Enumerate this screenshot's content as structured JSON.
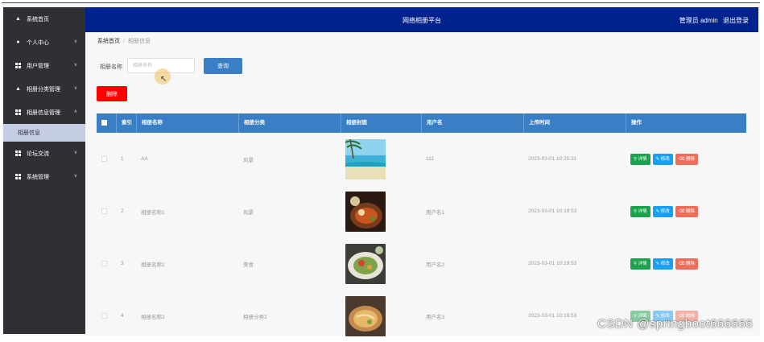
{
  "header": {
    "title": "网络相册平台",
    "admin_label": "管理员 admin",
    "logout_label": "退出登录"
  },
  "sidebar": {
    "items": [
      {
        "label": "系统首页",
        "icon": "home-icon"
      },
      {
        "label": "个人中心",
        "icon": "user-icon"
      },
      {
        "label": "用户管理",
        "icon": "grid-icon"
      },
      {
        "label": "相册分类管理",
        "icon": "thumb-icon"
      },
      {
        "label": "相册信息管理",
        "icon": "grid-icon"
      },
      {
        "label": "论坛交流",
        "icon": "grid-icon"
      },
      {
        "label": "系统管理",
        "icon": "grid-icon"
      }
    ],
    "sub_item": "相册信息"
  },
  "breadcrumb": {
    "home": "系统首页",
    "current": "相册信息"
  },
  "search": {
    "label": "相册名称",
    "placeholder": "相册名称",
    "button": "查询"
  },
  "delete_button": "删除",
  "table": {
    "columns": [
      "索引",
      "相册名称",
      "相册分类",
      "相册封面",
      "用户名",
      "上传时间",
      "操作"
    ],
    "rows": [
      {
        "index": "1",
        "name": "AA",
        "category": "风景",
        "cover": "beach-photo",
        "user": "111",
        "time": "2023-03-01 10:25:31"
      },
      {
        "index": "2",
        "name": "相册名称1",
        "category": "风景",
        "cover": "food-photo",
        "user": "用户名1",
        "time": "2023-03-01 10:19:53"
      },
      {
        "index": "3",
        "name": "相册名称2",
        "category": "美食",
        "cover": "salad-photo",
        "user": "用户名2",
        "time": "2023-03-01 10:19:53"
      },
      {
        "index": "4",
        "name": "相册名称3",
        "category": "相册分类3",
        "cover": "noodle-photo",
        "user": "用户名3",
        "time": "2023-03-01 10:19:53"
      }
    ],
    "actions": {
      "detail": "详情",
      "edit": "修改",
      "delete": "删除"
    }
  },
  "watermark": "CSDN @springboot666666",
  "colors": {
    "header": "#00228c",
    "sidebar": "#2f3033",
    "primary": "#3a7fc5",
    "danger": "#ff0000"
  }
}
